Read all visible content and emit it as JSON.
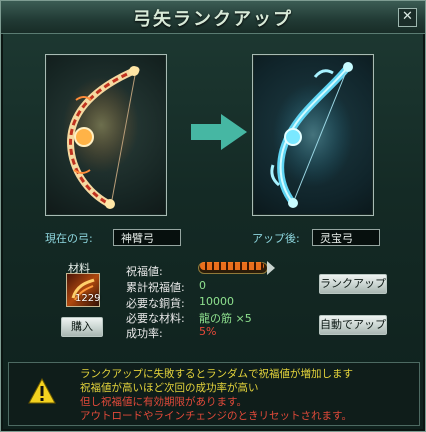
{
  "window": {
    "title": "弓矢ランクアップ"
  },
  "icons": {
    "close": "close-icon",
    "arrow": "arrow-right-icon",
    "warning": "warning-icon"
  },
  "current": {
    "label": "現在の弓:",
    "name": "神臂弓"
  },
  "after": {
    "label": "アップ後:",
    "name": "灵宝弓"
  },
  "material": {
    "label": "材料",
    "count": "1229",
    "buy_label": "購入"
  },
  "stats": {
    "blessing_label": "祝福値:",
    "blessing_level": 0.0,
    "cumulative_label": "累計祝福値:",
    "cumulative_value": "0",
    "cost_label": "必要な銅貨:",
    "cost_value": "10000",
    "material_label": "必要な材料:",
    "material_value": "龍の筋 ×5",
    "rate_label": "成功率:",
    "rate_value": "5%"
  },
  "buttons": {
    "rank_up": "ランクアップ",
    "auto_rank_up": "自動でアップ"
  },
  "notice": {
    "lines": [
      "ランクアップに失敗するとランダムで祝福値が増加します",
      "祝福値が高いほど次回の成功率が高い",
      "但し祝福値に有効期限があります。",
      "アウトロードやラインチェンジのときリセットされます。"
    ]
  },
  "colors": {
    "accent": "#8ed7df",
    "stat_value": "#8ee08e",
    "notice_yellow": "#e3d33b",
    "notice_red": "#e24a3a"
  }
}
